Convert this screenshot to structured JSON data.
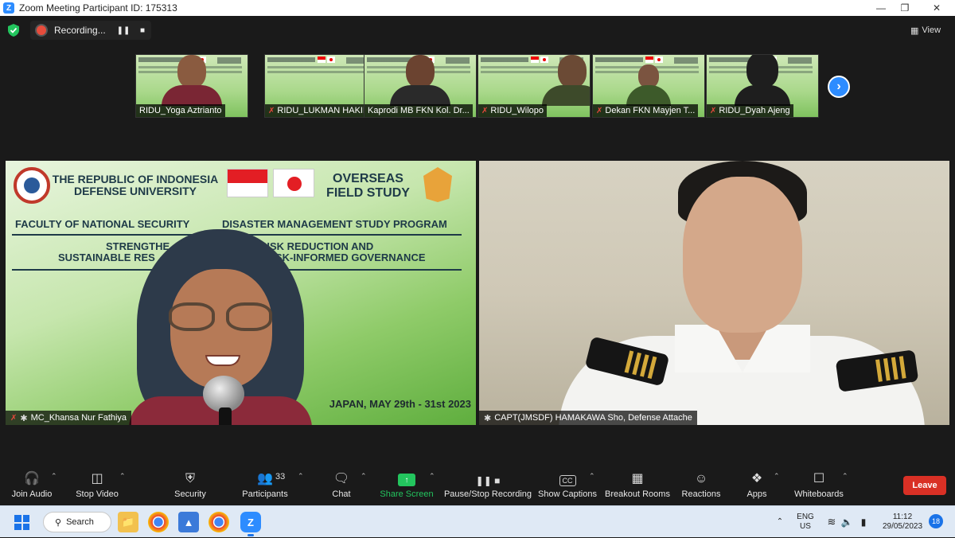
{
  "window": {
    "title": "Zoom Meeting Participant ID: 175313"
  },
  "meeting": {
    "recording_label": "Recording...",
    "view_label": "View"
  },
  "thumbnails": [
    {
      "name": "RIDU_Yoga Aztrianto",
      "muted": false
    },
    {
      "name": "RIDU_LUKMAN HAKIM",
      "muted": true
    },
    {
      "name": "Kaprodi MB FKN Kol. Dr...",
      "muted": false
    },
    {
      "name": "RIDU_Wilopo",
      "muted": true
    },
    {
      "name": "Dekan FKN Mayjen T...",
      "muted": true
    },
    {
      "name": "RIDU_Dyah Ajeng",
      "muted": true
    }
  ],
  "slide": {
    "university_line1": "THE REPUBLIC OF INDONESIA",
    "university_line2": "DEFENSE UNIVERSITY",
    "program_line1": "OVERSEAS",
    "program_line2": "FIELD STUDY",
    "faculty": "FACULTY OF NATIONAL SECURITY",
    "study_program": "DISASTER MANAGEMENT STUDY PROGRAM",
    "theme_line1": "STRENGTHE",
    "theme_line1b": "R RISK REDUCTION AND",
    "theme_line2": "SUSTAINABLE RES",
    "theme_line2b": "RISK-INFORMED GOVERNANCE",
    "date": "JAPAN, MAY 29th - 31st 2023"
  },
  "main_videos": [
    {
      "name": "MC_Khansa Nur Fathiya"
    },
    {
      "name": "CAPT(JMSDF) HAMAKAWA Sho, Defense Attache"
    }
  ],
  "toolbar": {
    "join_audio": "Join Audio",
    "stop_video": "Stop Video",
    "security": "Security",
    "participants": "Participants",
    "participants_count": "33",
    "chat": "Chat",
    "share_screen": "Share Screen",
    "pause_stop_recording": "Pause/Stop Recording",
    "show_captions": "Show Captions",
    "captions_icon_text": "CC",
    "breakout_rooms": "Breakout Rooms",
    "reactions": "Reactions",
    "apps": "Apps",
    "whiteboards": "Whiteboards",
    "leave": "Leave"
  },
  "taskbar": {
    "search_label": "Search",
    "lang_line1": "ENG",
    "lang_line2": "US",
    "time": "11:12",
    "date": "29/05/2023",
    "notification_count": "18"
  },
  "colors": {
    "zoom_blue": "#2d8cff",
    "leave_red": "#d93025",
    "share_green": "#23c55e",
    "mute_red": "#e5483c"
  }
}
